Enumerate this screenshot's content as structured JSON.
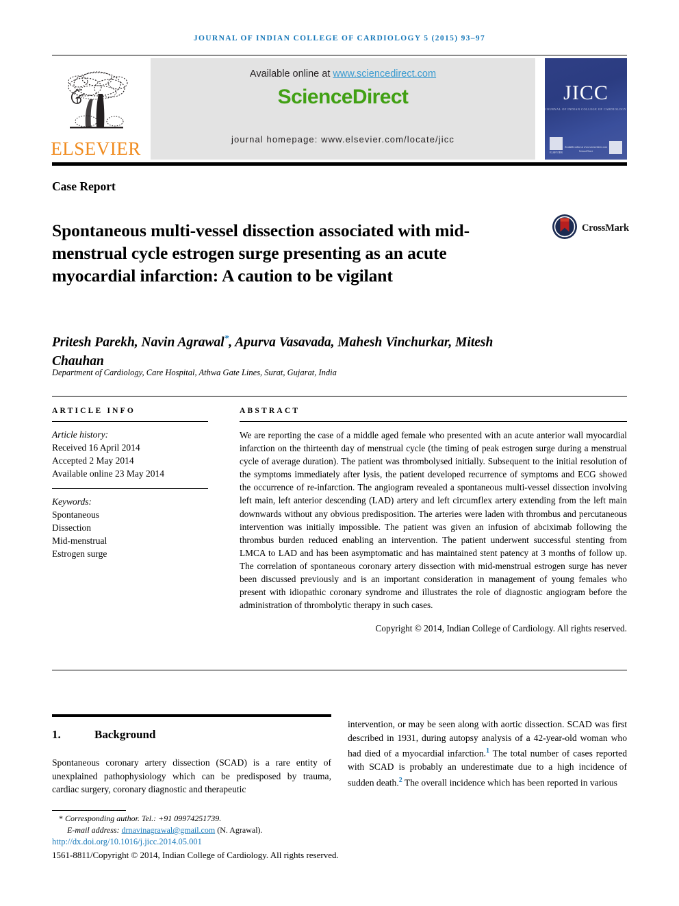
{
  "running_head": "Journal of Indian College of Cardiology 5 (2015) 93–97",
  "masthead": {
    "elsevier_logo_label": "ELSEVIER",
    "available_prefix": "Available online at ",
    "available_url": "www.sciencedirect.com",
    "sciencedirect_wordmark": "ScienceDirect",
    "journal_homepage": "journal homepage: www.elsevier.com/locate/jicc",
    "cover": {
      "acronym": "JICC",
      "subtitle": "JOURNAL OF INDIAN COLLEGE OF CARDIOLOGY",
      "publisher_note": "Available online at www.sciencedirect.com",
      "publisher_name": "ScienceDirect"
    },
    "colors": {
      "elsevier_orange": "#f08a1d",
      "sciencedirect_green": "#41a014",
      "link_blue": "#3b9bd0",
      "cover_blue": "#2f3f85"
    }
  },
  "article": {
    "type": "Case Report",
    "title": "Spontaneous multi-vessel dissection associated with mid-menstrual cycle estrogen surge presenting as an acute myocardial infarction: A caution to be vigilant",
    "crossmark_label": "CrossMark",
    "authors": "Pritesh Parekh, Navin Agrawal*, Apurva Vasavada, Mahesh Vinchurkar, Mitesh Chauhan",
    "authors_pre": "Pritesh Parekh, Navin Agrawal",
    "authors_star": "*",
    "authors_post": ", Apurva Vasavada, Mahesh Vinchurkar, Mitesh Chauhan",
    "affiliation": "Department of Cardiology, Care Hospital, Athwa Gate Lines, Surat, Gujarat, India"
  },
  "article_info": {
    "heading": "ARTICLE INFO",
    "history_label": "Article history:",
    "received": "Received 16 April 2014",
    "accepted": "Accepted 2 May 2014",
    "available_online": "Available online 23 May 2014",
    "keywords_label": "Keywords:",
    "keywords": [
      "Spontaneous",
      "Dissection",
      "Mid-menstrual",
      "Estrogen surge"
    ]
  },
  "abstract": {
    "heading": "ABSTRACT",
    "body": "We are reporting the case of a middle aged female who presented with an acute anterior wall myocardial infarction on the thirteenth day of menstrual cycle (the timing of peak estrogen surge during a menstrual cycle of average duration). The patient was thrombolysed initially. Subsequent to the initial resolution of the symptoms immediately after lysis, the patient developed recurrence of symptoms and ECG showed the occurrence of re-infarction. The angiogram revealed a spontaneous multi-vessel dissection involving left main, left anterior descending (LAD) artery and left circumflex artery extending from the left main downwards without any obvious predisposition. The arteries were laden with thrombus and percutaneous intervention was initially impossible. The patient was given an infusion of abciximab following the thrombus burden reduced enabling an intervention. The patient underwent successful stenting from LMCA to LAD and has been asymptomatic and has maintained stent patency at 3 months of follow up. The correlation of spontaneous coronary artery dissection with mid-menstrual estrogen surge has never been discussed previously and is an important consideration in management of young females who present with idiopathic coronary syndrome and illustrates the role of diagnostic angiogram before the administration of thrombolytic therapy in such cases.",
    "copyright": "Copyright © 2014, Indian College of Cardiology. All rights reserved."
  },
  "body": {
    "section_number": "1.",
    "section_title": "Background",
    "left_paragraph": "Spontaneous coronary artery dissection (SCAD) is a rare entity of unexplained pathophysiology which can be predisposed by trauma, cardiac surgery, coronary diagnostic and therapeutic",
    "right_part1": "intervention, or may be seen along with aortic dissection. SCAD was first described in 1931, during autopsy analysis of a 42-year-old woman who had died of a myocardial infarction.",
    "right_ref1": "1",
    "right_part2": " The total number of cases reported with SCAD is probably an underestimate due to a high incidence of sudden death.",
    "right_ref2": "2",
    "right_part3": " The overall incidence which has been reported in various"
  },
  "footer": {
    "star": "*",
    "corresponding": "Corresponding author. Tel.: +91 09974251739.",
    "email_label": "E-mail address:",
    "email": "drnavinagrawal@gmail.com",
    "email_owner": "(N. Agrawal).",
    "doi": "http://dx.doi.org/10.1016/j.jicc.2014.05.001",
    "issn_line": "1561-8811/Copyright © 2014, Indian College of Cardiology. All rights reserved."
  }
}
